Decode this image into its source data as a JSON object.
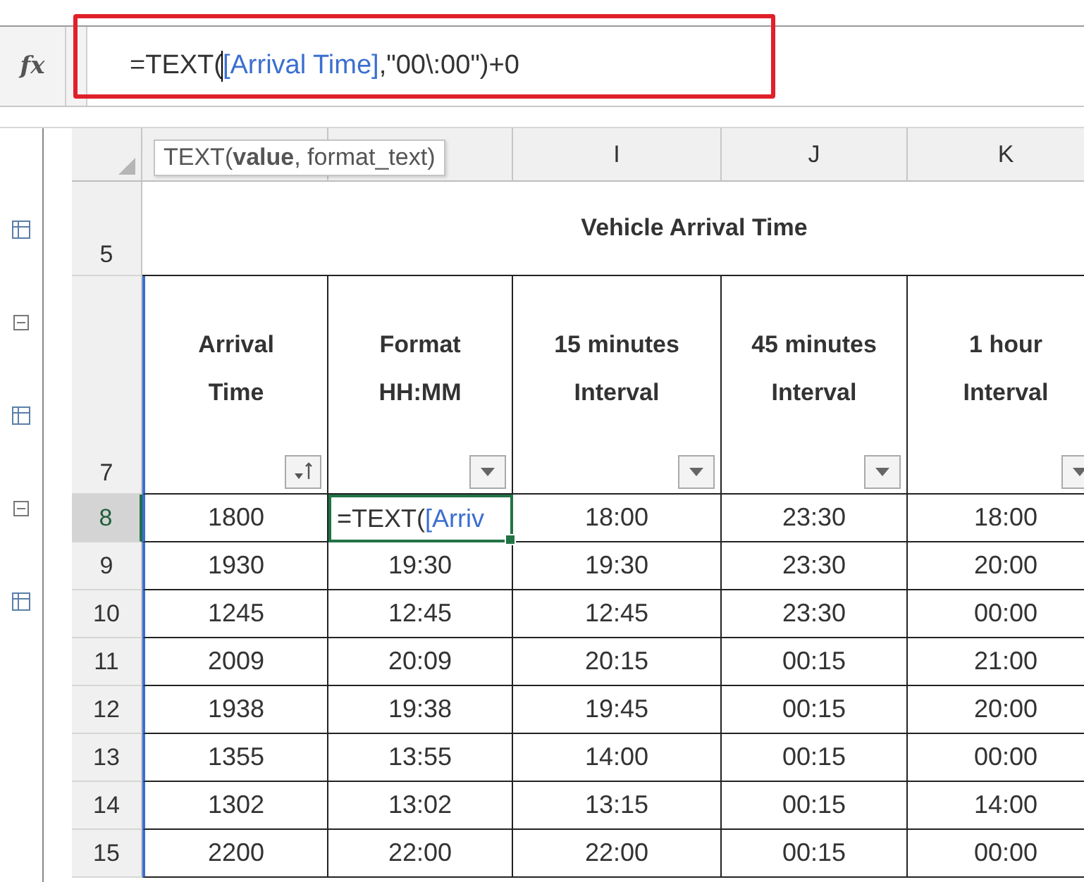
{
  "formula_bar": {
    "function_label": "fx",
    "highlighted": true,
    "formula": [
      {
        "kind": "text",
        "text": "=TEXT("
      },
      {
        "kind": "reference",
        "text": "[Arrival Time]"
      },
      {
        "kind": "text",
        "text": ",\"00\\:00\")+0"
      }
    ]
  },
  "tooltip": "TEXT(**value**, format_text)",
  "column_letters": [
    "I",
    "J",
    "K"
  ],
  "title_row": {
    "row_number": "5",
    "title": "Vehicle Arrival Time"
  },
  "header_row": {
    "row_number": "7",
    "columns": [
      {
        "label_lines": [
          "Arrival",
          "Time"
        ],
        "kind": "sorted",
        "referenced": true
      },
      {
        "label_lines": [
          "Format",
          "HH:MM"
        ],
        "kind": "dropdown",
        "referenced": false
      },
      {
        "label_lines": [
          "15 minutes",
          "Interval"
        ],
        "kind": "dropdown",
        "referenced": false
      },
      {
        "label_lines": [
          "45 minutes",
          "Interval"
        ],
        "kind": "dropdown",
        "referenced": false
      },
      {
        "label_lines": [
          "1 hour",
          "Interval"
        ],
        "kind": "dropdown",
        "referenced": false
      }
    ]
  },
  "rows": [
    {
      "row_number": "8",
      "cells": [
        {
          "kind": "value",
          "text": "1800"
        },
        {
          "kind": "editing",
          "parts": [
            {
              "kind": "text",
              "text": "=TEXT("
            },
            {
              "kind": "reference",
              "text": "[Arriv"
            }
          ]
        },
        {
          "kind": "value",
          "text": "18:00"
        },
        {
          "kind": "value",
          "text": "23:30"
        },
        {
          "kind": "value",
          "text": "18:00"
        }
      ]
    },
    {
      "row_number": "9",
      "cells": [
        {
          "kind": "value",
          "text": "1930"
        },
        {
          "kind": "value",
          "text": "19:30"
        },
        {
          "kind": "value",
          "text": "19:30"
        },
        {
          "kind": "value",
          "text": "23:30"
        },
        {
          "kind": "value",
          "text": "20:00"
        }
      ]
    },
    {
      "row_number": "10",
      "cells": [
        {
          "kind": "value",
          "text": "1245"
        },
        {
          "kind": "value",
          "text": "12:45"
        },
        {
          "kind": "value",
          "text": "12:45"
        },
        {
          "kind": "value",
          "text": "23:30"
        },
        {
          "kind": "value",
          "text": "00:00"
        }
      ]
    },
    {
      "row_number": "11",
      "cells": [
        {
          "kind": "value",
          "text": "2009"
        },
        {
          "kind": "value",
          "text": "20:09"
        },
        {
          "kind": "value",
          "text": "20:15"
        },
        {
          "kind": "value",
          "text": "00:15"
        },
        {
          "kind": "value",
          "text": "21:00"
        }
      ]
    },
    {
      "row_number": "12",
      "cells": [
        {
          "kind": "value",
          "text": "1938"
        },
        {
          "kind": "value",
          "text": "19:38"
        },
        {
          "kind": "value",
          "text": "19:45"
        },
        {
          "kind": "value",
          "text": "00:15"
        },
        {
          "kind": "value",
          "text": "20:00"
        }
      ]
    },
    {
      "row_number": "13",
      "cells": [
        {
          "kind": "value",
          "text": "1355"
        },
        {
          "kind": "value",
          "text": "13:55"
        },
        {
          "kind": "value",
          "text": "14:00"
        },
        {
          "kind": "value",
          "text": "00:15"
        },
        {
          "kind": "value",
          "text": "00:00"
        }
      ]
    },
    {
      "row_number": "14",
      "cells": [
        {
          "kind": "value",
          "text": "1302"
        },
        {
          "kind": "value",
          "text": "13:02"
        },
        {
          "kind": "value",
          "text": "13:15"
        },
        {
          "kind": "value",
          "text": "00:15"
        },
        {
          "kind": "value",
          "text": "14:00"
        }
      ]
    },
    {
      "row_number": "15",
      "cells": [
        {
          "kind": "value",
          "text": "2200"
        },
        {
          "kind": "value",
          "text": "22:00"
        },
        {
          "kind": "value",
          "text": "22:00"
        },
        {
          "kind": "value",
          "text": "00:15"
        },
        {
          "kind": "value",
          "text": "00:00"
        }
      ]
    }
  ]
}
